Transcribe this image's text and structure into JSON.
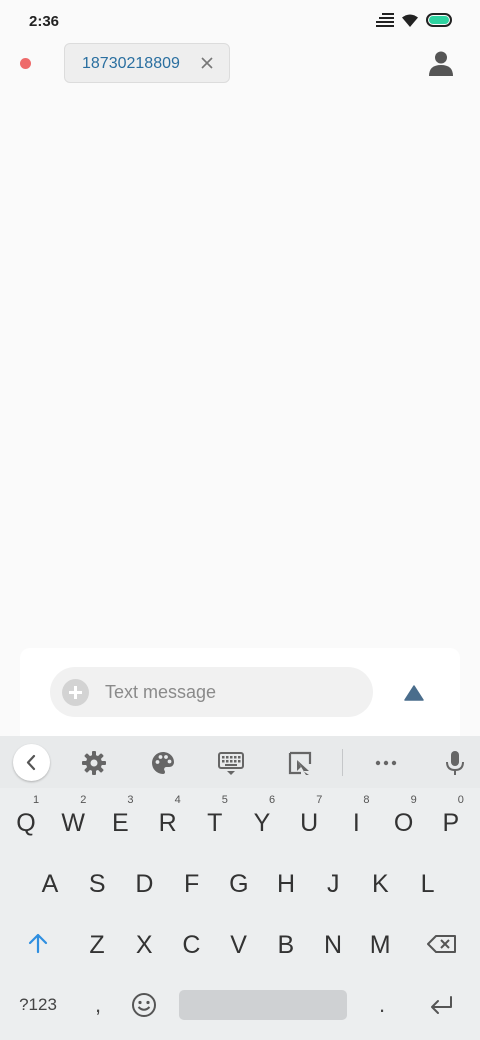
{
  "status_bar": {
    "time": "2:36",
    "icons": [
      "signal-bars-icon",
      "wifi-icon",
      "battery-icon"
    ],
    "battery_color": "#2ed3a0"
  },
  "header": {
    "recipient_chip": "18730218809",
    "remove_icon": "close-icon",
    "contact_icon": "person-icon",
    "indicator_color": "#ee6a6a"
  },
  "compose": {
    "placeholder": "Text message",
    "attach_icon": "add-icon",
    "send_icon": "send-icon"
  },
  "keyboard": {
    "toolbar": [
      "back-icon",
      "gear-icon",
      "palette-icon",
      "keyboard-icon",
      "clipboard-icon",
      "more-icon",
      "mic-icon"
    ],
    "row1": [
      "Q",
      "W",
      "E",
      "R",
      "T",
      "Y",
      "U",
      "I",
      "O",
      "P"
    ],
    "row1_hints": [
      "1",
      "2",
      "3",
      "4",
      "5",
      "6",
      "7",
      "8",
      "9",
      "0"
    ],
    "row2": [
      "A",
      "S",
      "D",
      "F",
      "G",
      "H",
      "J",
      "K",
      "L"
    ],
    "row3": [
      "Z",
      "X",
      "C",
      "V",
      "B",
      "N",
      "M"
    ],
    "shift_icon": "shift-icon",
    "backspace_icon": "backspace-icon",
    "symbols_label": "?123",
    "comma": ",",
    "emoji_icon": "emoji-icon",
    "period": ".",
    "enter_icon": "enter-icon"
  }
}
